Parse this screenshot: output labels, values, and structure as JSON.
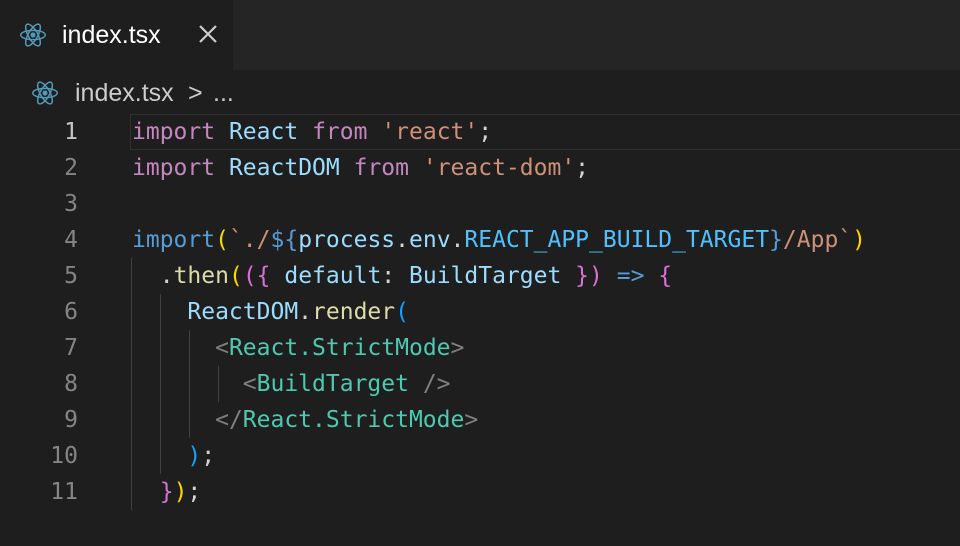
{
  "tab": {
    "label": "index.tsx",
    "icon": "react-icon",
    "close_icon": "close-icon"
  },
  "breadcrumb": {
    "file": "index.tsx",
    "separator": ">",
    "more": "..."
  },
  "line_numbers": [
    "1",
    "2",
    "3",
    "4",
    "5",
    "6",
    "7",
    "8",
    "9",
    "10",
    "11"
  ],
  "code": {
    "l1": {
      "kw1": "import",
      "name": "React",
      "kw2": "from",
      "str": "'react'",
      "end": ";"
    },
    "l2": {
      "kw1": "import",
      "name": "ReactDOM",
      "kw2": "from",
      "str": "'react-dom'",
      "end": ";"
    },
    "l4": {
      "kw": "import",
      "open": "(",
      "tick1": "`./",
      "interp_open": "${",
      "obj": "process",
      "dot1": ".",
      "prop": "env",
      "dot2": ".",
      "const": "REACT_APP_BUILD_TARGET",
      "interp_close": "}",
      "tail": "/App`",
      "close": ")"
    },
    "l5": {
      "dot": ".",
      "fn": "then",
      "p1": "(",
      "p2": "({",
      "param": " default",
      "colon": ":",
      "alias": " BuildTarget",
      "pclose": " })",
      "arrow": " =>",
      "brace": " {"
    },
    "l6": {
      "obj": "ReactDOM",
      "dot": ".",
      "fn": "render",
      "open": "("
    },
    "l7": {
      "lt": "<",
      "tag": "React.StrictMode",
      "gt": ">"
    },
    "l8": {
      "lt": "<",
      "tag": "BuildTarget",
      "gt": " />"
    },
    "l9": {
      "lt": "</",
      "tag": "React.StrictMode",
      "gt": ">"
    },
    "l10": {
      "close": ")",
      "end": ";"
    },
    "l11": {
      "brace": "}",
      "paren": ")",
      "end": ";"
    }
  },
  "colors": {
    "background": "#1e1e1e",
    "keyword": "#c586c0",
    "variable": "#9cdcfe",
    "string": "#ce9178",
    "function": "#dcdcaa",
    "type": "#4ec9b0",
    "constant": "#4fc1ff"
  }
}
